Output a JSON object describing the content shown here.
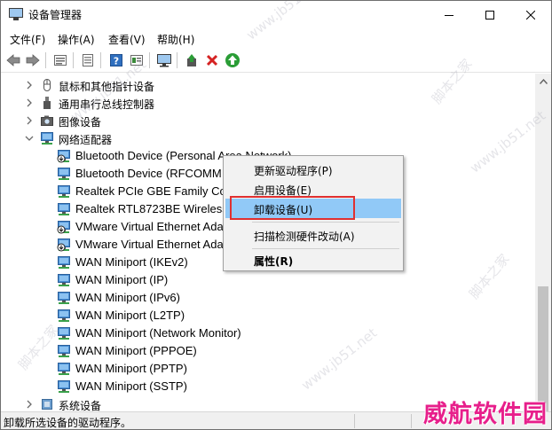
{
  "window": {
    "title": "设备管理器"
  },
  "menubar": {
    "items": [
      "文件(F)",
      "操作(A)",
      "查看(V)",
      "帮助(H)"
    ]
  },
  "toolbar": {
    "icons": [
      "back-icon",
      "forward-icon",
      "properties-view-icon",
      "show-hide-icon",
      "help-icon",
      "view-icon",
      "monitor-icon",
      "update-driver-icon",
      "uninstall-icon",
      "scan-icon"
    ],
    "colors": {
      "uninstall": "#d52222",
      "scan": "#2a9d36",
      "update": "#2a9d36"
    }
  },
  "tree": {
    "rows": [
      {
        "label": "鼠标和其他指针设备",
        "kind": "category",
        "expanded": false,
        "icon": "mouse-icon"
      },
      {
        "label": "通用串行总线控制器",
        "kind": "category",
        "expanded": false,
        "icon": "usb-icon"
      },
      {
        "label": "图像设备",
        "kind": "category",
        "expanded": false,
        "icon": "camera-icon"
      },
      {
        "label": "网络适配器",
        "kind": "category",
        "expanded": true,
        "icon": "network-adapter-icon"
      },
      {
        "label": "Bluetooth Device (Personal Area Network)",
        "kind": "device",
        "selected": true,
        "icon": "network-adapter-down-icon"
      },
      {
        "label": "Bluetooth Device (RFCOMM",
        "kind": "device",
        "icon": "network-adapter-icon"
      },
      {
        "label": "Realtek PCIe GBE Family Cor",
        "kind": "device",
        "icon": "network-adapter-icon"
      },
      {
        "label": "Realtek RTL8723BE Wireless",
        "kind": "device",
        "icon": "network-adapter-icon"
      },
      {
        "label": "VMware Virtual Ethernet Ada",
        "kind": "device",
        "icon": "network-adapter-down-icon"
      },
      {
        "label": "VMware Virtual Ethernet Ada",
        "kind": "device",
        "icon": "network-adapter-down-icon"
      },
      {
        "label": "WAN Miniport (IKEv2)",
        "kind": "device",
        "icon": "network-adapter-icon"
      },
      {
        "label": "WAN Miniport (IP)",
        "kind": "device",
        "icon": "network-adapter-icon"
      },
      {
        "label": "WAN Miniport (IPv6)",
        "kind": "device",
        "icon": "network-adapter-icon"
      },
      {
        "label": "WAN Miniport (L2TP)",
        "kind": "device",
        "icon": "network-adapter-icon"
      },
      {
        "label": "WAN Miniport (Network Monitor)",
        "kind": "device",
        "icon": "network-adapter-icon"
      },
      {
        "label": "WAN Miniport (PPPOE)",
        "kind": "device",
        "icon": "network-adapter-icon"
      },
      {
        "label": "WAN Miniport (PPTP)",
        "kind": "device",
        "icon": "network-adapter-icon"
      },
      {
        "label": "WAN Miniport (SSTP)",
        "kind": "device",
        "icon": "network-adapter-icon"
      },
      {
        "label": "系统设备",
        "kind": "category",
        "expanded": false,
        "icon": "system-device-icon"
      }
    ]
  },
  "context_menu": {
    "items": [
      {
        "label": "更新驱动程序(P)"
      },
      {
        "label": "启用设备(E)"
      },
      {
        "label": "卸载设备(U)",
        "highlighted": true
      },
      {
        "label": "扫描检测硬件改动(A)"
      },
      {
        "label": "属性(R)",
        "bold": true
      }
    ]
  },
  "statusbar": {
    "text": "卸载所选设备的驱动程序。"
  },
  "watermarks": {
    "site": "www.jb51.net",
    "brand_cn": "脚本之家",
    "corner_brand": "威航软件园"
  },
  "colors": {
    "highlight": "#91c9f7",
    "annotation_box": "#e03030",
    "brand": "#e71f8b"
  }
}
